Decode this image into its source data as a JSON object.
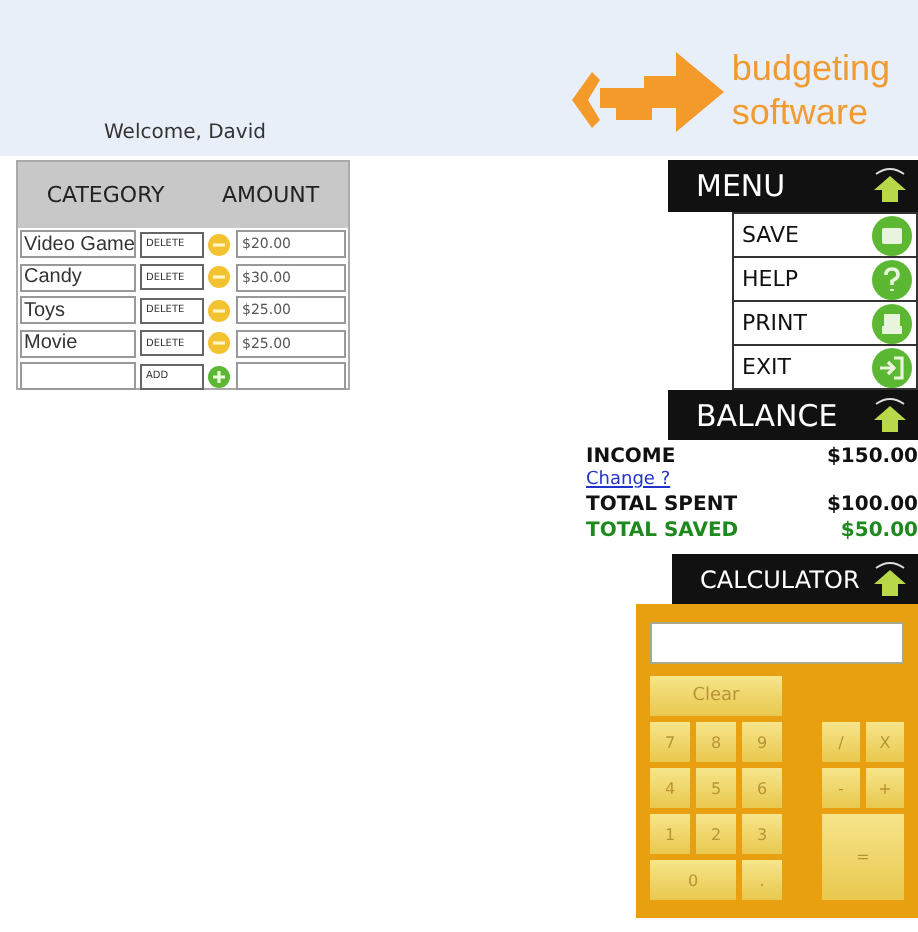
{
  "header": {
    "welcome": "Welcome, David",
    "logo_lines": [
      "budgeting",
      "software"
    ]
  },
  "table": {
    "columns": [
      "CATEGORY",
      "AMOUNT"
    ],
    "rows": [
      {
        "category": "Video Game",
        "action": "DELETE",
        "kind": "delete",
        "amount": "$20.00"
      },
      {
        "category": "Candy",
        "action": "DELETE",
        "kind": "delete",
        "amount": "$30.00"
      },
      {
        "category": "Toys",
        "action": "DELETE",
        "kind": "delete",
        "amount": "$25.00"
      },
      {
        "category": "Movie",
        "action": "DELETE",
        "kind": "delete",
        "amount": "$25.00"
      },
      {
        "category": "",
        "action": "ADD",
        "kind": "add",
        "amount": ""
      }
    ]
  },
  "menu": {
    "title": "MENU",
    "items": [
      {
        "label": "SAVE",
        "kind": "save"
      },
      {
        "label": "HELP",
        "kind": "help"
      },
      {
        "label": "PRINT",
        "kind": "print"
      },
      {
        "label": "EXIT",
        "kind": "exit"
      }
    ]
  },
  "balance": {
    "title": "BALANCE",
    "rows": [
      {
        "label": "INCOME",
        "value": "$150.00",
        "kind": "plain"
      },
      {
        "label": "Change ?",
        "kind": "link"
      },
      {
        "label": "TOTAL SPENT",
        "value": "$100.00",
        "kind": "plain"
      },
      {
        "label": "TOTAL SAVED",
        "value": "$50.00",
        "kind": "saved"
      }
    ]
  },
  "calculator": {
    "title": "CALCULATOR",
    "keypad": [
      {
        "label": "Clear",
        "kind": "clear"
      },
      {
        "label": "7",
        "kind": "key"
      },
      {
        "label": "8",
        "kind": "key"
      },
      {
        "label": "9",
        "kind": "key"
      },
      {
        "label": "4",
        "kind": "key"
      },
      {
        "label": "5",
        "kind": "key"
      },
      {
        "label": "6",
        "kind": "key"
      },
      {
        "label": "1",
        "kind": "key"
      },
      {
        "label": "2",
        "kind": "key"
      },
      {
        "label": "3",
        "kind": "key"
      },
      {
        "label": "0",
        "kind": "wide"
      },
      {
        "label": ".",
        "kind": "key"
      }
    ],
    "ops": [
      {
        "label": "/",
        "kind": "key"
      },
      {
        "label": "X",
        "kind": "key"
      },
      {
        "label": "-",
        "kind": "key"
      },
      {
        "label": "+",
        "kind": "key"
      },
      {
        "label": "=",
        "kind": "tall"
      }
    ]
  }
}
